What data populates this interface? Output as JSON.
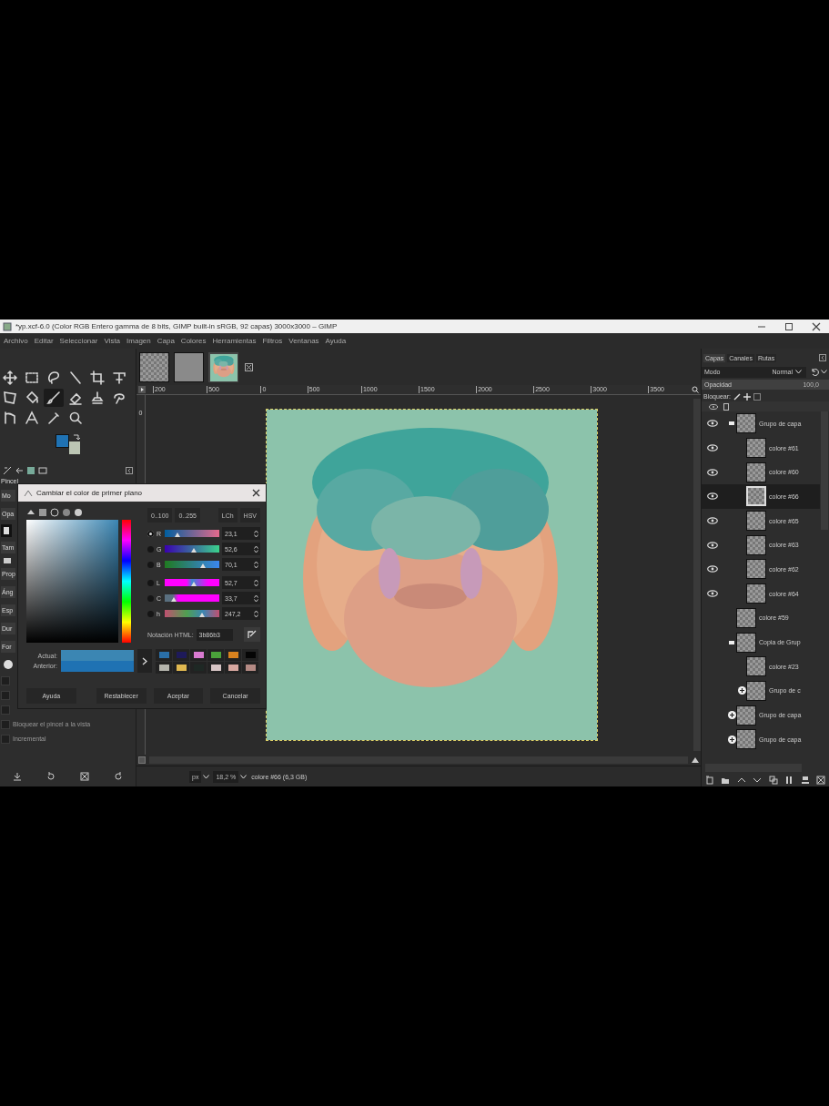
{
  "window": {
    "title": "*yp.xcf-6.0 (Color RGB Entero gamma de 8 bits, GIMP built-in sRGB, 92 capas) 3000x3000 – GIMP"
  },
  "menu": [
    "Archivo",
    "Editar",
    "Seleccionar",
    "Vista",
    "Imagen",
    "Capa",
    "Colores",
    "Herramientas",
    "Filtros",
    "Ventanas",
    "Ayuda"
  ],
  "tools": [
    {
      "kind": "move",
      "selected": false
    },
    {
      "kind": "rect-select",
      "selected": false
    },
    {
      "kind": "lasso",
      "selected": false
    },
    {
      "kind": "wand",
      "selected": false
    },
    {
      "kind": "crop",
      "selected": false
    },
    {
      "kind": "warp",
      "selected": false
    },
    {
      "kind": "transform",
      "selected": false
    },
    {
      "kind": "bucket",
      "selected": false
    },
    {
      "kind": "brush",
      "selected": true
    },
    {
      "kind": "eraser",
      "selected": false
    },
    {
      "kind": "clone",
      "selected": false
    },
    {
      "kind": "smudge",
      "selected": false
    },
    {
      "kind": "paths",
      "selected": false
    },
    {
      "kind": "text",
      "selected": false
    },
    {
      "kind": "picker",
      "selected": false
    },
    {
      "kind": "zoom",
      "selected": false
    }
  ],
  "color_swatches": [
    {
      "kind": "background",
      "color": "#bcc6b4"
    },
    {
      "kind": "foreground",
      "color": "#1f72b3"
    }
  ],
  "tool_options": {
    "title": "Pincel",
    "fields": [
      "Mo",
      "Opa",
      "Tam",
      "Prop",
      "Áng",
      "Esp",
      "Dur",
      "For"
    ],
    "checkboxes": [
      {
        "checked": false
      },
      {
        "checked": false
      },
      {
        "checked": false
      },
      {
        "label": "Bloquear el pincel a la vista",
        "checked": false
      },
      {
        "label": "Incremental",
        "checked": false
      }
    ]
  },
  "image_tabs": [
    {
      "kind": "empty",
      "selected": false
    },
    {
      "kind": "grey",
      "selected": false
    },
    {
      "kind": "picture",
      "selected": true
    }
  ],
  "ruler": [
    "200",
    "500",
    "0",
    "500",
    "1000",
    "1500",
    "2000",
    "2500",
    "3000",
    "3500"
  ],
  "vruler": [
    "0"
  ],
  "status": {
    "unit": "px",
    "zoom": "18,2 %",
    "message": "colore #66 (6,3 GB)"
  },
  "dialog": {
    "title": "Cambiar el color de primer plano",
    "scales": [
      {
        "label": "0..100",
        "selected": false
      },
      {
        "label": "0..255",
        "selected": false
      }
    ],
    "models": [
      {
        "label": "LCh",
        "selected": false
      },
      {
        "label": "HSV",
        "selected": false
      }
    ],
    "channels": [
      {
        "label": "R",
        "selected": true,
        "level": 0.231,
        "value": "23,1"
      },
      {
        "label": "G",
        "selected": false,
        "level": 0.526,
        "value": "52,6"
      },
      {
        "label": "B",
        "selected": false,
        "level": 0.701,
        "value": "70,1"
      },
      {
        "label": "L",
        "selected": false,
        "level": 0.527,
        "value": "52,7"
      },
      {
        "label": "C",
        "selected": false,
        "level": 0.17,
        "value": "33,7"
      },
      {
        "label": "h",
        "selected": false,
        "level": 0.687,
        "value": "247,2"
      }
    ],
    "html_label": "Notación HTML:",
    "html_value": "3b86b3",
    "current_label": "Actual:",
    "previous_label": "Anterior:",
    "previous": {
      "color": "#1f72b3"
    },
    "history": [
      {
        "color": "#2a6fa8"
      },
      {
        "color": "#1e1a5a"
      },
      {
        "color": "#d97ad0"
      },
      {
        "color": "#4aa23a"
      },
      {
        "color": "#d9821e"
      },
      {
        "color": "#050505"
      },
      {
        "color": "#b4b4ac"
      },
      {
        "color": "#e0b850"
      },
      {
        "color": "#1e2824"
      },
      {
        "color": "#d6c4c4"
      },
      {
        "color": "#d8a8a0"
      },
      {
        "color": "#b48a84"
      }
    ],
    "buttons": [
      "Ayuda",
      "Restablecer",
      "Aceptar",
      "Cancelar"
    ]
  },
  "layers": {
    "tabs": [
      {
        "label": "Capas",
        "selected": true
      },
      {
        "label": "Canales",
        "selected": false
      },
      {
        "label": "Rutas",
        "selected": false
      }
    ],
    "mode_label": "Modo",
    "mode": "Normal",
    "opacity_label": "Opacidad",
    "opacity": "100,0",
    "lock_label": "Bloquear:",
    "items": [
      {
        "name": "Grupo de capa",
        "visible": true,
        "expanded": true,
        "selected": false,
        "children": [
          {
            "name": "colore #61",
            "visible": true,
            "selected": false
          },
          {
            "name": "colore #60",
            "visible": true,
            "selected": false
          },
          {
            "name": "colore #66",
            "visible": true,
            "selected": true
          },
          {
            "name": "colore #65",
            "visible": true,
            "selected": false
          },
          {
            "name": "colore #63",
            "visible": true,
            "selected": false
          },
          {
            "name": "colore #62",
            "visible": true,
            "selected": false
          },
          {
            "name": "colore #64",
            "visible": true,
            "selected": false
          }
        ]
      },
      {
        "name": "colore #59",
        "visible": false,
        "selected": false
      },
      {
        "name": "Copia de Grup",
        "visible": false,
        "expanded": true,
        "selected": false,
        "children": [
          {
            "name": "colore #23",
            "visible": false,
            "selected": false
          },
          {
            "name": "Grupo de c",
            "visible": false,
            "expanded": false,
            "selected": false
          }
        ]
      },
      {
        "name": "Grupo de capa",
        "visible": false,
        "expanded": false,
        "selected": false
      },
      {
        "name": "Grupo de capa",
        "visible": false,
        "expanded": false,
        "selected": false
      }
    ]
  }
}
